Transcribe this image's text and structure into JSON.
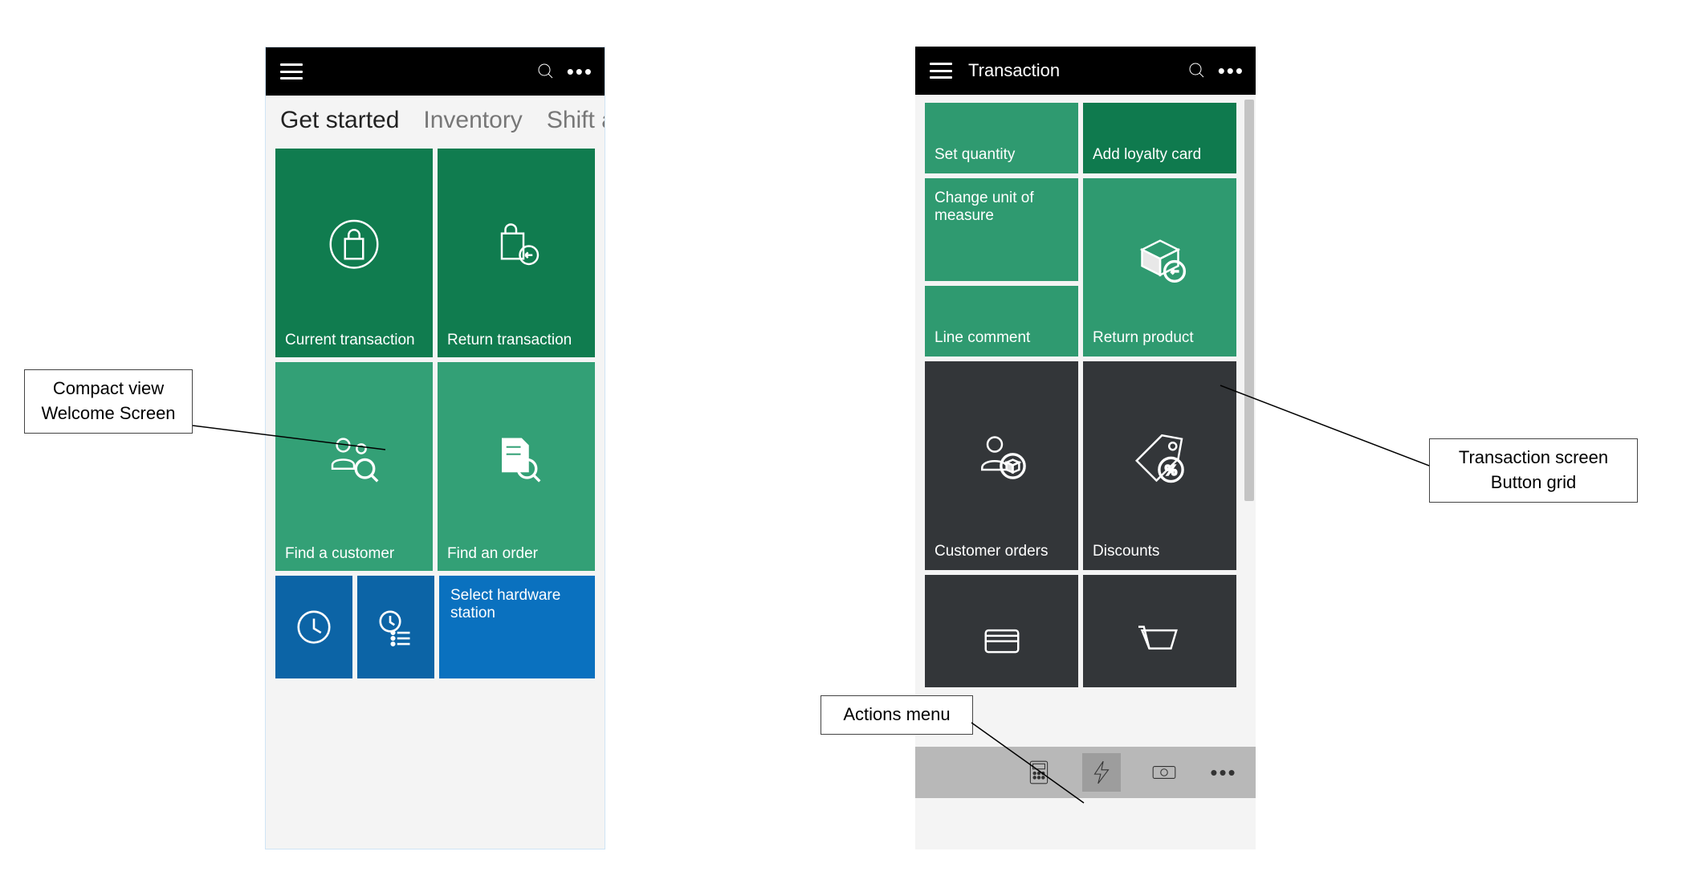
{
  "welcome": {
    "titlebar": {
      "title": ""
    },
    "pivot": {
      "items": [
        "Get started",
        "Inventory",
        "Shift and"
      ],
      "active": 0
    },
    "tiles": {
      "current_transaction": "Current transaction",
      "return_transaction": "Return transaction",
      "find_customer": "Find a customer",
      "find_order": "Find an order",
      "select_hw": "Select hardware station"
    }
  },
  "transaction": {
    "titlebar": {
      "title": "Transaction"
    },
    "tiles": {
      "set_quantity": "Set quantity",
      "add_loyalty": "Add loyalty card",
      "change_uom": "Change unit of measure",
      "line_comment": "Line comment",
      "return_product": "Return product",
      "customer_orders": "Customer orders",
      "discounts": "Discounts"
    }
  },
  "annotations": {
    "welcome_label": "Compact view\nWelcome Screen",
    "button_grid_label": "Transaction screen\nButton grid",
    "actions_menu_label": "Actions menu"
  }
}
